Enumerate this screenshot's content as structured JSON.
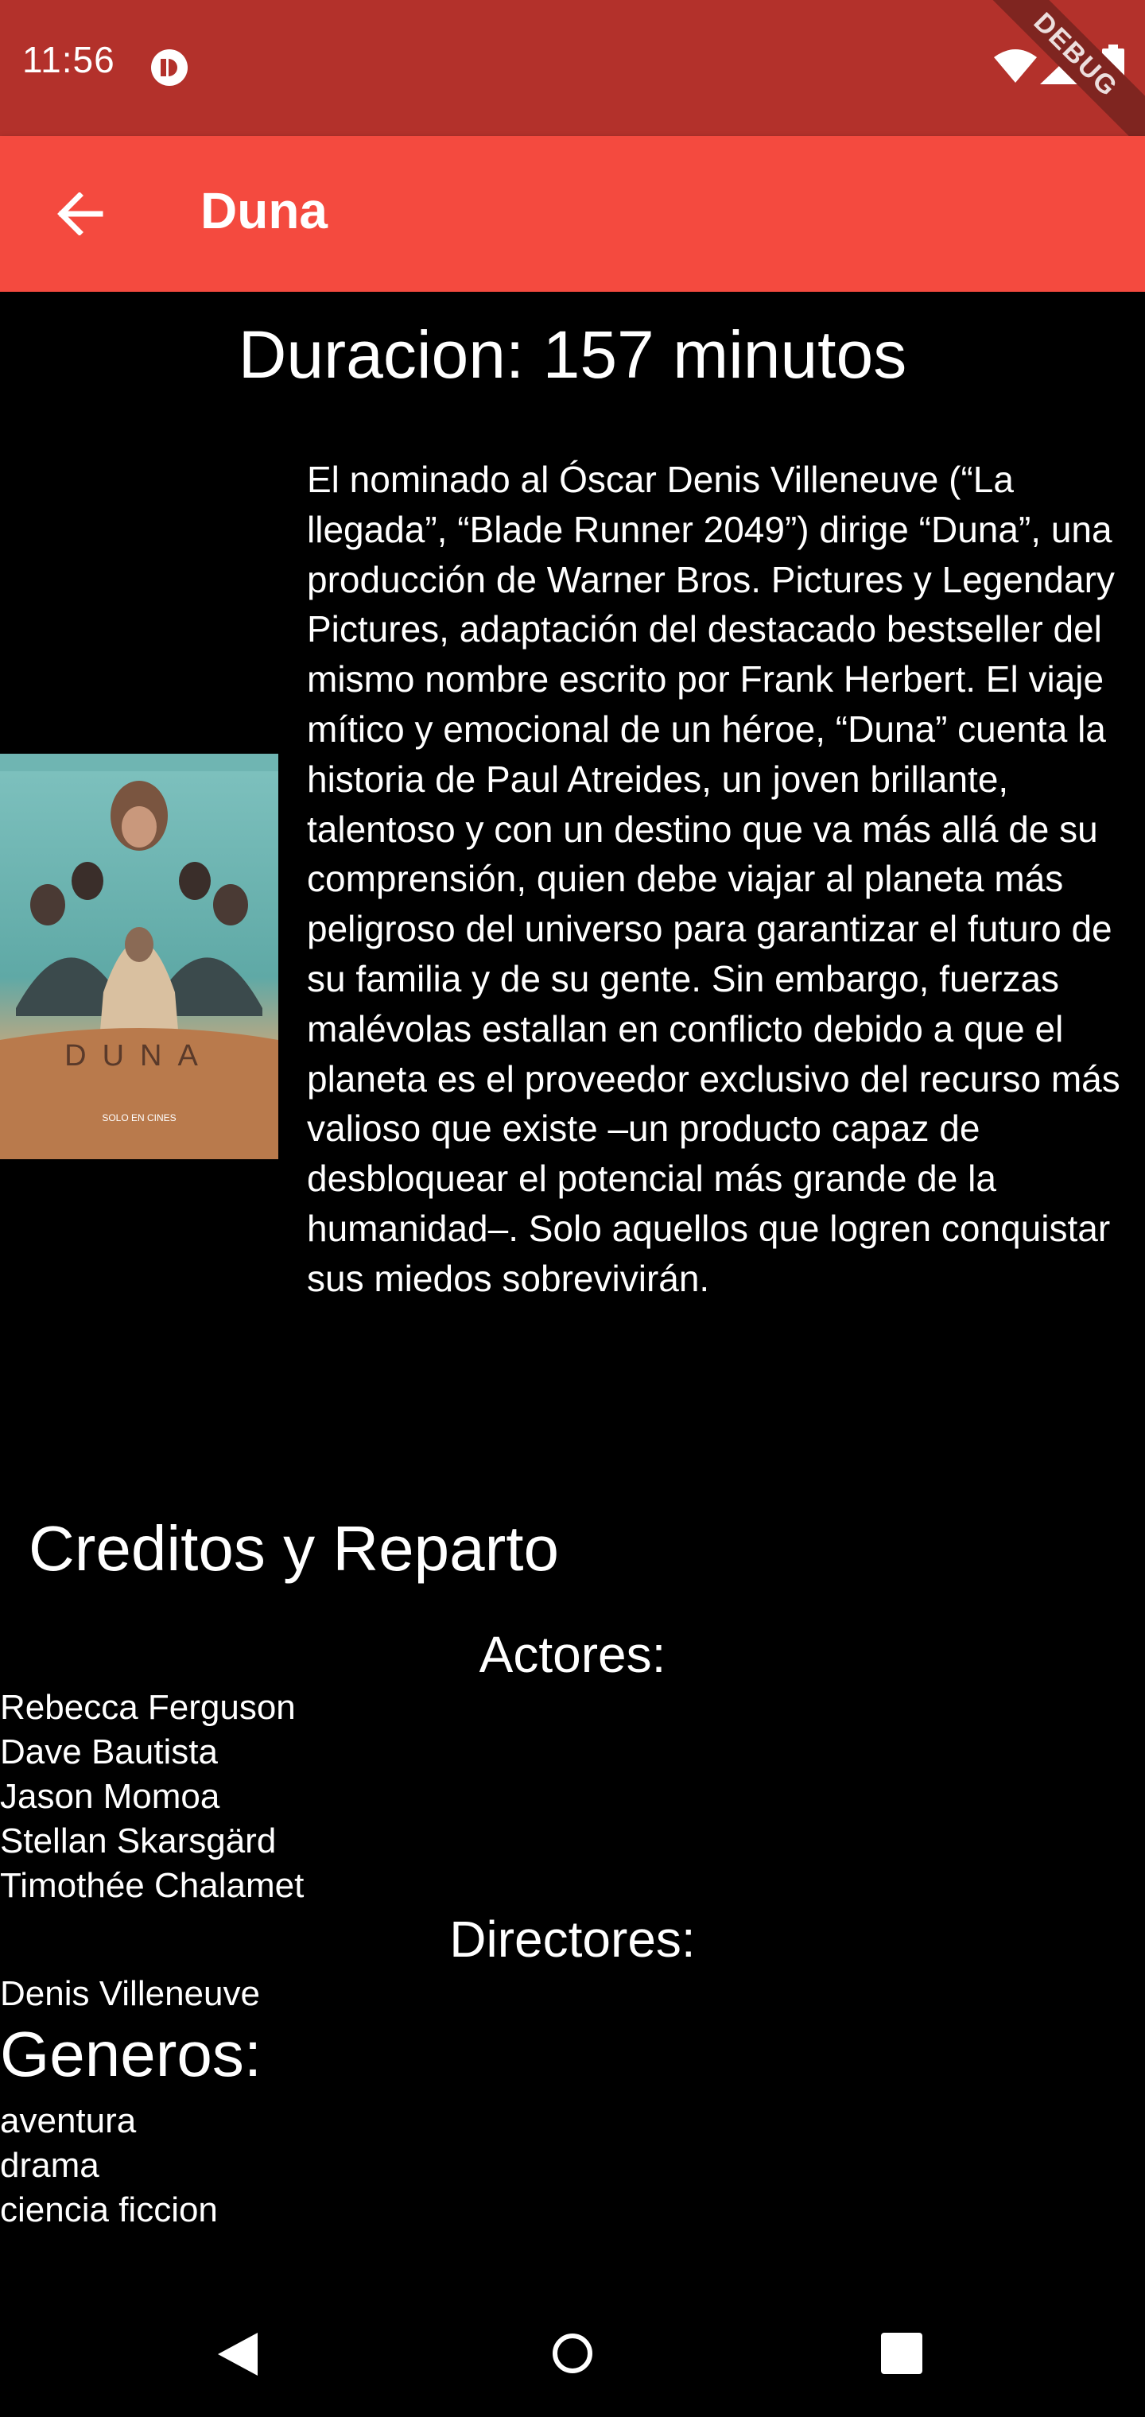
{
  "status_bar": {
    "time": "11:56",
    "debug_label": "DEBUG",
    "icons": [
      "media-icon",
      "wifi-icon",
      "signal-icon",
      "battery-icon"
    ]
  },
  "app_bar": {
    "title": "Duna",
    "back_icon": "arrow-left-icon",
    "color": "#f44a3f"
  },
  "movie": {
    "duration": "Duracion: 157 minutos",
    "synopsis": "El nominado al Óscar Denis Villeneuve (“La llegada”, “Blade Runner 2049”) dirige “Duna”, una producción de Warner Bros. Pictures y Legendary Pictures, adaptación del destacado bestseller del mismo nombre escrito por Frank Herbert. El viaje mítico y emocional de un héroe, “Duna” cuenta la historia de Paul Atreides, un joven brillante, talentoso y con un destino que va más allá de su comprensión, quien debe viajar al planeta más peligroso del universo para garantizar el futuro de su familia y de su gente. Sin embargo, fuerzas malévolas estallan en conflicto debido a que el planeta es el proveedor exclusivo del recurso más valioso que existe –un producto capaz de desbloquear el potencial más grande de la humanidad–. Solo aquellos que logren conquistar sus miedos sobrevivirán.",
    "poster": {
      "title_text": "DUNA",
      "tagline": "SOLO EN CINES"
    }
  },
  "credits": {
    "heading": "Creditos y Reparto",
    "actors_heading": "Actores:",
    "actors": [
      "Rebecca Ferguson",
      "Dave Bautista",
      "Jason Momoa",
      "Stellan Skarsgärd",
      "Timothée Chalamet"
    ],
    "directors_heading": "Directores:",
    "directors": [
      "Denis Villeneuve"
    ]
  },
  "genres": {
    "heading": "Generos:",
    "items": [
      "aventura",
      "drama",
      "ciencia ficcion"
    ]
  },
  "nav_bar": {
    "icons": [
      "back-triangle-icon",
      "home-circle-icon",
      "recents-square-icon"
    ]
  }
}
